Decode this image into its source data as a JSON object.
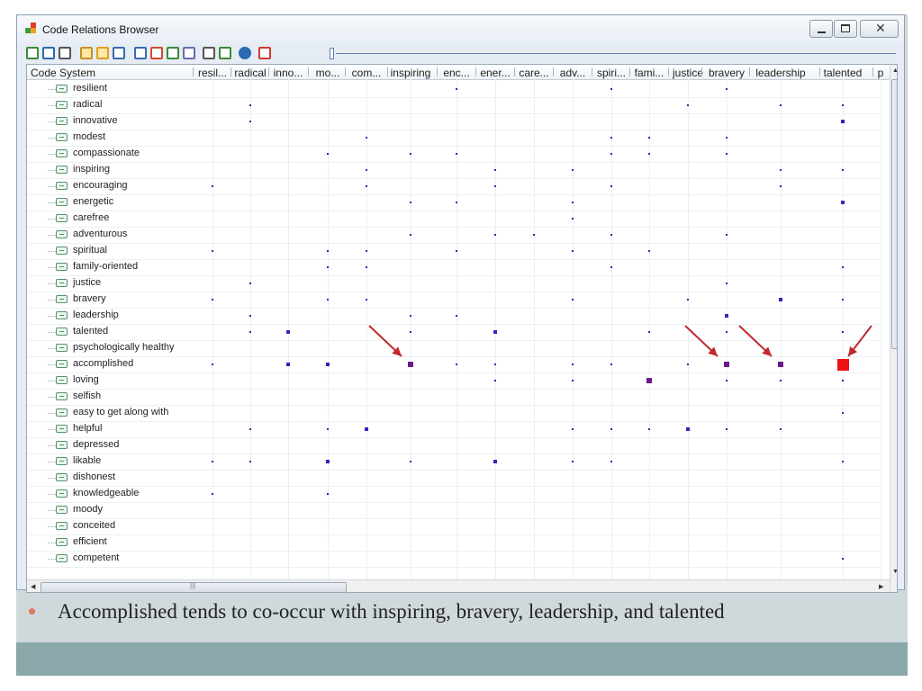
{
  "window": {
    "title": "Code Relations Browser"
  },
  "header": {
    "code_system": "Code System",
    "columns": [
      "resil...",
      "radical",
      "inno...",
      "mo...",
      "com...",
      "inspiring",
      "enc...",
      "ener...",
      "care...",
      "adv...",
      "spiri...",
      "fami...",
      "justice",
      "bravery",
      "leadership",
      "talented",
      "p"
    ]
  },
  "rows": [
    "resilient",
    "radical",
    "innovative",
    "modest",
    "compassionate",
    "inspiring",
    "encouraging",
    "energetic",
    "carefree",
    "adventurous",
    "spiritual",
    "family-oriented",
    "justice",
    "bravery",
    "leadership",
    "talented",
    "psychologically healthy",
    "accomplished",
    "loving",
    "selfish",
    "easy to get along with",
    "helpful",
    "depressed",
    "likable",
    "dishonest",
    "knowledgeable",
    "moody",
    "conceited",
    "efficient",
    "competent"
  ],
  "cells": [
    [
      0,
      6,
      1
    ],
    [
      0,
      10,
      1
    ],
    [
      0,
      13,
      1
    ],
    [
      1,
      1,
      1
    ],
    [
      1,
      12,
      1
    ],
    [
      1,
      14,
      1
    ],
    [
      1,
      15,
      1
    ],
    [
      2,
      1,
      1
    ],
    [
      2,
      15,
      2
    ],
    [
      3,
      4,
      1
    ],
    [
      3,
      10,
      1
    ],
    [
      3,
      11,
      1
    ],
    [
      3,
      13,
      1
    ],
    [
      4,
      3,
      1
    ],
    [
      4,
      5,
      1
    ],
    [
      4,
      6,
      1
    ],
    [
      4,
      10,
      1
    ],
    [
      4,
      11,
      1
    ],
    [
      4,
      13,
      1
    ],
    [
      5,
      4,
      1
    ],
    [
      5,
      7,
      1
    ],
    [
      5,
      9,
      1
    ],
    [
      5,
      14,
      1
    ],
    [
      5,
      15,
      1
    ],
    [
      6,
      0,
      1
    ],
    [
      6,
      4,
      1
    ],
    [
      6,
      7,
      1
    ],
    [
      6,
      10,
      1
    ],
    [
      6,
      14,
      1
    ],
    [
      7,
      5,
      1
    ],
    [
      7,
      6,
      1
    ],
    [
      7,
      9,
      1
    ],
    [
      7,
      15,
      2
    ],
    [
      8,
      9,
      1
    ],
    [
      9,
      5,
      1
    ],
    [
      9,
      7,
      1
    ],
    [
      9,
      8,
      1
    ],
    [
      9,
      10,
      1
    ],
    [
      9,
      13,
      1
    ],
    [
      10,
      0,
      1
    ],
    [
      10,
      3,
      1
    ],
    [
      10,
      4,
      1
    ],
    [
      10,
      6,
      1
    ],
    [
      10,
      9,
      1
    ],
    [
      10,
      11,
      1
    ],
    [
      11,
      3,
      1
    ],
    [
      11,
      4,
      1
    ],
    [
      11,
      10,
      1
    ],
    [
      11,
      15,
      1
    ],
    [
      12,
      1,
      1
    ],
    [
      12,
      13,
      1
    ],
    [
      13,
      0,
      1
    ],
    [
      13,
      3,
      1
    ],
    [
      13,
      4,
      1
    ],
    [
      13,
      9,
      1
    ],
    [
      13,
      12,
      1
    ],
    [
      13,
      14,
      2
    ],
    [
      13,
      15,
      1
    ],
    [
      14,
      1,
      1
    ],
    [
      14,
      5,
      1
    ],
    [
      14,
      6,
      1
    ],
    [
      14,
      13,
      2
    ],
    [
      15,
      1,
      1
    ],
    [
      15,
      2,
      2
    ],
    [
      15,
      5,
      1
    ],
    [
      15,
      7,
      2
    ],
    [
      15,
      11,
      1
    ],
    [
      15,
      13,
      1
    ],
    [
      15,
      15,
      1
    ],
    [
      17,
      0,
      1
    ],
    [
      17,
      2,
      2
    ],
    [
      17,
      3,
      2
    ],
    [
      17,
      5,
      3
    ],
    [
      17,
      6,
      1
    ],
    [
      17,
      7,
      1
    ],
    [
      17,
      9,
      1
    ],
    [
      17,
      10,
      1
    ],
    [
      17,
      12,
      1
    ],
    [
      17,
      13,
      3
    ],
    [
      17,
      14,
      3
    ],
    [
      17,
      15,
      4
    ],
    [
      18,
      7,
      1
    ],
    [
      18,
      9,
      1
    ],
    [
      18,
      11,
      3
    ],
    [
      18,
      13,
      1
    ],
    [
      18,
      14,
      1
    ],
    [
      18,
      15,
      1
    ],
    [
      20,
      15,
      1
    ],
    [
      21,
      1,
      1
    ],
    [
      21,
      3,
      1
    ],
    [
      21,
      4,
      2
    ],
    [
      21,
      9,
      1
    ],
    [
      21,
      10,
      1
    ],
    [
      21,
      11,
      1
    ],
    [
      21,
      12,
      2
    ],
    [
      21,
      13,
      1
    ],
    [
      21,
      14,
      1
    ],
    [
      23,
      0,
      1
    ],
    [
      23,
      1,
      1
    ],
    [
      23,
      3,
      2
    ],
    [
      23,
      5,
      1
    ],
    [
      23,
      7,
      2
    ],
    [
      23,
      9,
      1
    ],
    [
      23,
      10,
      1
    ],
    [
      23,
      15,
      1
    ],
    [
      25,
      0,
      1
    ],
    [
      25,
      3,
      1
    ],
    [
      29,
      15,
      1
    ]
  ],
  "cell_colors": {
    "1": "#2b2bb0",
    "2": "#3a22b8",
    "3": "#6a1a8a",
    "4": "#ee1111"
  },
  "icons": {
    "arrow_color": "#c0282d",
    "toolbar": [
      "export-icon",
      "import-icon",
      "camera-icon",
      "columns-icon",
      "highlight-icon",
      "window-icon",
      "symbol-icon",
      "group-icon",
      "code-icon",
      "copy-icon",
      "list-icon",
      "refresh-icon",
      "info-icon",
      "run-icon"
    ]
  },
  "caption": {
    "text": "Accomplished tends to co-occur with inspiring, bravery, leadership, and talented"
  }
}
